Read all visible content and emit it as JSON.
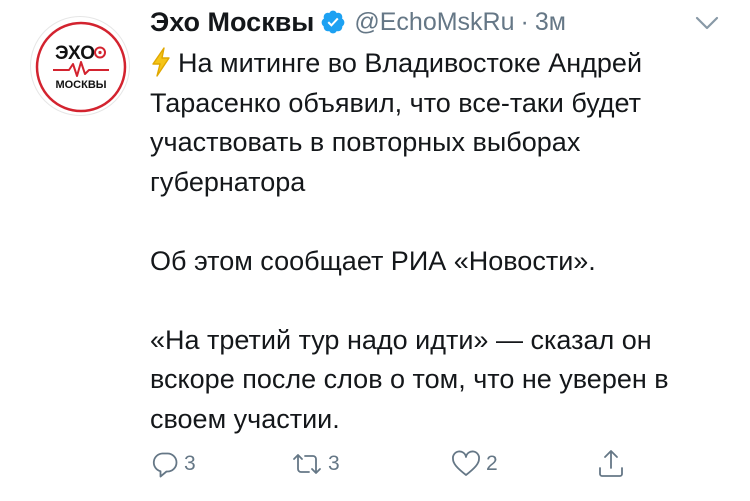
{
  "colors": {
    "verified": "#1da1f2",
    "secondary_text": "#657786",
    "primary_text": "#14171a",
    "bolt": "#f5c518",
    "logo_red": "#d3232f"
  },
  "icons": {
    "reply": "reply-icon",
    "retweet": "retweet-icon",
    "like": "heart-icon",
    "share": "share-icon",
    "caret": "chevron-down-icon",
    "verified": "verified-badge-icon",
    "bolt": "lightning-bolt-emoji"
  },
  "account": {
    "display_name": "Эхо Москвы",
    "handle": "@EchoMskRu",
    "separator": "·",
    "time": "3м",
    "logo_top": "ЭХО",
    "logo_bottom": "МОСКВЫ"
  },
  "tweet": {
    "paragraph1": "На митинге во Владивостоке Андрей Тарасенко объявил, что все-таки будет участвовать в повторных выборах губернатора",
    "paragraph2": "Об этом сообщает РИА «Новости».",
    "paragraph3": "«На третий тур надо идти» — сказал он вскоре после слов о том, что не уверен в своем участии."
  },
  "actions": {
    "reply_count": "3",
    "retweet_count": "3",
    "like_count": "2"
  }
}
